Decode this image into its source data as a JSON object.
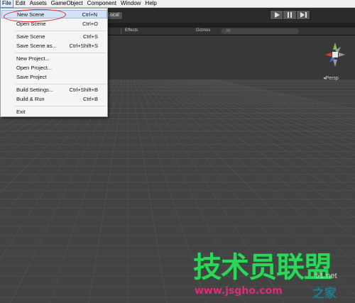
{
  "menubar": {
    "items": [
      "File",
      "Edit",
      "Assets",
      "GameObject",
      "Component",
      "Window",
      "Help"
    ]
  },
  "toolbar": {
    "local_label": "Local",
    "play_icons": [
      "play-icon",
      "pause-icon",
      "step-icon"
    ]
  },
  "scene_header": {
    "effects_label": "Effects",
    "gizmos_label": "Gizmos",
    "search_placeholder": "All"
  },
  "file_menu": {
    "items": [
      {
        "label": "New Scene",
        "shortcut": "Ctrl+N",
        "highlighted": true
      },
      {
        "label": "Open Scene",
        "shortcut": "Ctrl+O"
      },
      {
        "label": "Save Scene",
        "shortcut": "Ctrl+S"
      },
      {
        "label": "Save Scene as...",
        "shortcut": "Ctrl+Shift+S"
      },
      {
        "label": "New Project...",
        "shortcut": ""
      },
      {
        "label": "Open Project...",
        "shortcut": ""
      },
      {
        "label": "Save Project",
        "shortcut": ""
      },
      {
        "label": "Build Settings...",
        "shortcut": "Ctrl+Shift+B"
      },
      {
        "label": "Build & Run",
        "shortcut": "Ctrl+B"
      },
      {
        "label": "Exit",
        "shortcut": ""
      }
    ]
  },
  "viewport": {
    "projection_label": "Persp",
    "gizmo_axes": {
      "x_color": "#d33c2b",
      "y_color": "#7dc242",
      "z_color": "#3b6fd6"
    }
  },
  "watermark": {
    "main": "技术员联盟",
    "net": "51.net",
    "url": "www.jsgho.com",
    "sub": "之家"
  },
  "colors": {
    "annotation_circle": "#d62020",
    "watermark_green": "#2fd45a",
    "watermark_pink": "#e02a7a"
  }
}
